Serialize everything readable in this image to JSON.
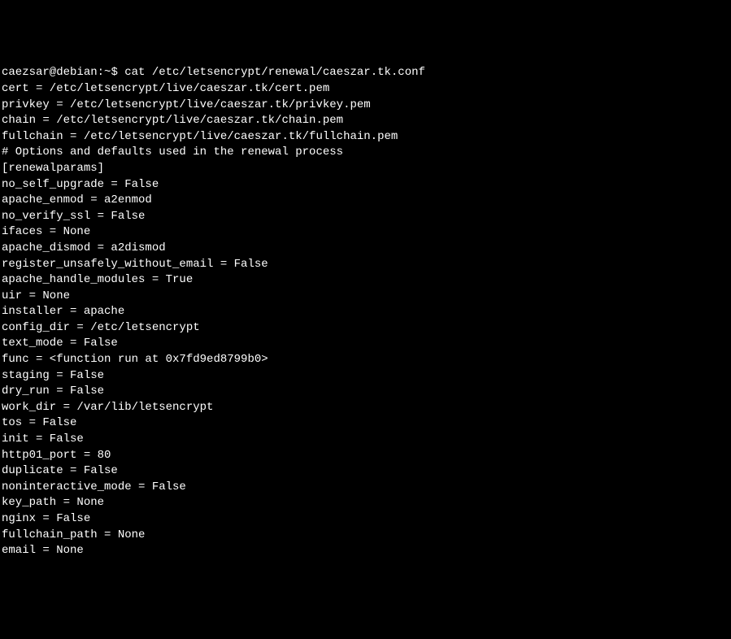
{
  "prompt": {
    "userhost": "caezsar@debian",
    "sep": ":",
    "path": "~",
    "dollar": "$"
  },
  "command": "cat /etc/letsencrypt/renewal/caeszar.tk.conf",
  "lines": [
    "cert = /etc/letsencrypt/live/caeszar.tk/cert.pem",
    "privkey = /etc/letsencrypt/live/caeszar.tk/privkey.pem",
    "chain = /etc/letsencrypt/live/caeszar.tk/chain.pem",
    "fullchain = /etc/letsencrypt/live/caeszar.tk/fullchain.pem",
    "",
    "# Options and defaults used in the renewal process",
    "[renewalparams]",
    "no_self_upgrade = False",
    "apache_enmod = a2enmod",
    "no_verify_ssl = False",
    "ifaces = None",
    "apache_dismod = a2dismod",
    "register_unsafely_without_email = False",
    "apache_handle_modules = True",
    "uir = None",
    "installer = apache",
    "config_dir = /etc/letsencrypt",
    "text_mode = False",
    "func = <function run at 0x7fd9ed8799b0>",
    "staging = False",
    "dry_run = False",
    "work_dir = /var/lib/letsencrypt",
    "tos = False",
    "init = False",
    "http01_port = 80",
    "duplicate = False",
    "noninteractive_mode = False",
    "key_path = None",
    "nginx = False",
    "fullchain_path = None",
    "email = None"
  ]
}
